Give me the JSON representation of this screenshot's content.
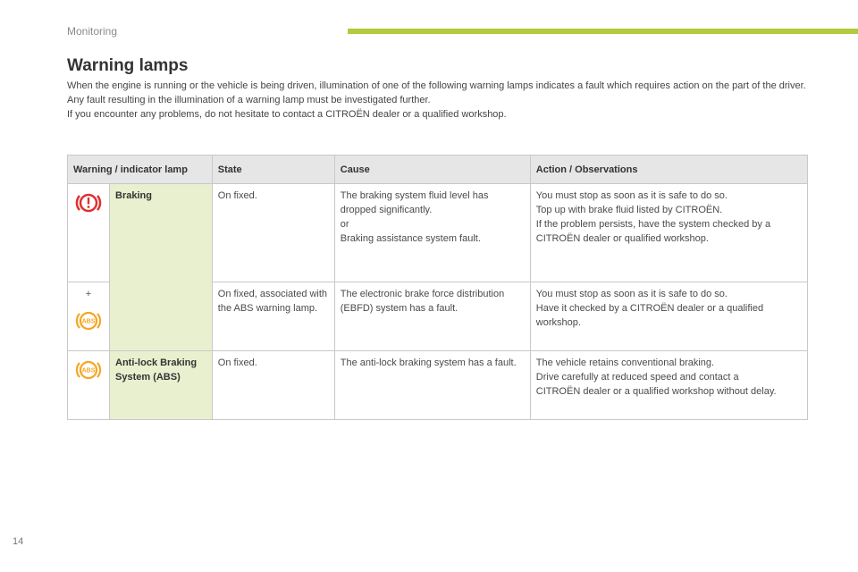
{
  "header": {
    "section": "Monitoring"
  },
  "title": "Warning lamps",
  "intro": [
    "When the engine is running or the vehicle is being driven, illumination of one of the following warning lamps indicates a fault which requires action on the part of the driver.",
    "Any fault resulting in the illumination of a warning lamp must be investigated further.",
    "If you encounter any problems, do not hesitate to contact a CITROËN dealer or a qualified workshop."
  ],
  "table": {
    "headers": [
      "Warning / indicator lamp",
      "State",
      "Cause",
      "Action / Observations"
    ],
    "rows": [
      {
        "icon": "brake-warning-icon",
        "name": "Braking",
        "state": "On fixed.",
        "cause": [
          "The braking system fluid level has dropped significantly.",
          "or",
          "Braking assistance system fault."
        ],
        "action": [
          "You must stop as soon as it is safe to do so.",
          "Top up with brake fluid listed by CITROËN.",
          "If the problem persists, have the system checked by a CITROËN dealer or qualified workshop."
        ]
      },
      {
        "icon": "abs-icon",
        "plus": "+",
        "state": "On fixed, associated with the ABS warning lamp.",
        "cause": [
          "The electronic brake force distribution (EBFD) system has a fault."
        ],
        "action": [
          "You must stop as soon as it is safe to do so.",
          "Have it checked by a CITROËN dealer or a qualified workshop."
        ]
      },
      {
        "icon": "abs-icon",
        "name": "Anti-lock Braking System (ABS)",
        "state": "On fixed.",
        "cause": [
          "The anti-lock braking system has a fault."
        ],
        "action": [
          "The vehicle retains conventional braking.",
          "Drive carefully at reduced speed and contact a CITROËN dealer or a qualified workshop without delay."
        ]
      }
    ]
  },
  "page_number": "14",
  "colors": {
    "accent": "#b5c93d",
    "red_lamp": "#e03030",
    "amber_lamp": "#f5a623",
    "name_cell": "#e8f0cf"
  }
}
